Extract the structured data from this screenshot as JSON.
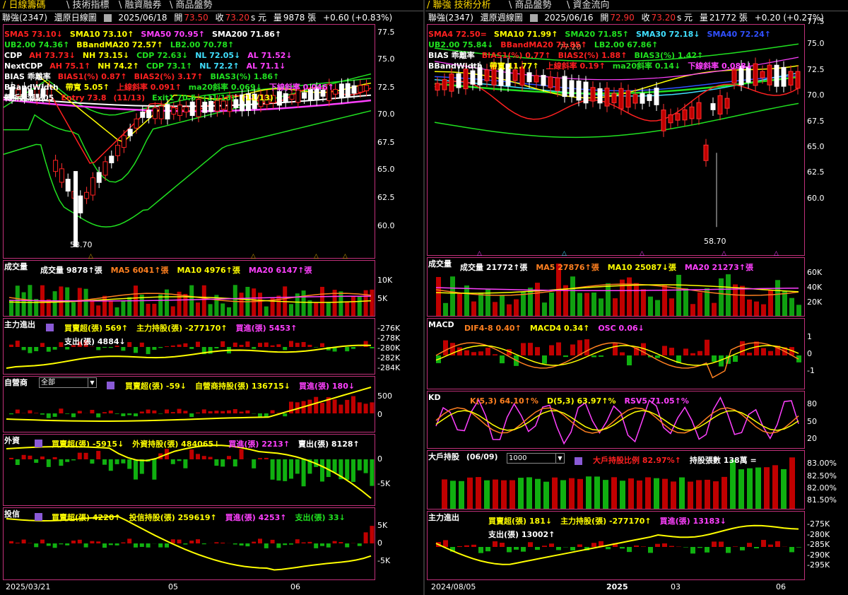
{
  "left": {
    "tabs": [
      "日線籌碼",
      "技術指標",
      "融資融券",
      "商品盤勢"
    ],
    "header": {
      "stock": "聯強(2347)",
      "view": "還原日線圖",
      "date": "2025/06/18",
      "open_l": "開",
      "open": "73.50",
      "close_l": "收",
      "close": "73.20",
      "unit": "s 元",
      "vol_l": "量",
      "vol": "9878 張",
      "chg": "+0.60 (+0.83%)"
    },
    "main_legend": [
      {
        "t": "SMA5 73.10↓",
        "c": "#ff2020"
      },
      {
        "t": "SMA10 73.10↑",
        "c": "#ffff00"
      },
      {
        "t": "SMA50 70.95↑",
        "c": "#ff40ff"
      },
      {
        "t": "SMA200 71.86↑",
        "c": "#ffffff"
      },
      {
        "t": "UB2.00 74.36↑",
        "c": "#20e020"
      },
      {
        "t": "BBandMA20 72.57↑",
        "c": "#ffff00"
      },
      {
        "t": "LB2.00 70.78↑",
        "c": "#20e020"
      },
      {
        "t": "CDP",
        "c": "#ffffff"
      },
      {
        "t": "AH 73.73↓",
        "c": "#ff2020"
      },
      {
        "t": "NH 73.15↓",
        "c": "#ffff00"
      },
      {
        "t": "CDP 72.63↓",
        "c": "#20e020"
      },
      {
        "t": "NL 72.05↓",
        "c": "#40e0ff"
      },
      {
        "t": "AL 71.52↓",
        "c": "#ff40ff"
      },
      {
        "t": "NextCDP",
        "c": "#ffffff"
      },
      {
        "t": "AH 75.1↑",
        "c": "#ff2020"
      },
      {
        "t": "NH 74.2↑",
        "c": "#ffff00"
      },
      {
        "t": "CDP 73.1↑",
        "c": "#20e020"
      },
      {
        "t": "NL 72.2↑",
        "c": "#40e0ff"
      },
      {
        "t": "AL 71.1↓",
        "c": "#ff40ff"
      },
      {
        "t": "BIAS 乖離率",
        "c": "#ffffff"
      },
      {
        "t": "BIAS1(%) 0.87↑",
        "c": "#ff2020"
      },
      {
        "t": "BIAS2(%) 3.17↑",
        "c": "#ff2020"
      },
      {
        "t": "BIAS3(%) 1.86↑",
        "c": "#20e020"
      },
      {
        "t": "BBandWidth",
        "c": "#ffffff"
      },
      {
        "t": "帶寬 5.05↑",
        "c": "#ffff00"
      },
      {
        "t": "上線斜率 0.091↑",
        "c": "#ff2020"
      },
      {
        "t": "ma20斜率 0.069↓",
        "c": "#20e020"
      },
      {
        "t": "下線斜率 0.046↑",
        "c": "#ff40ff"
      },
      {
        "t": "轉折起漲點05",
        "c": "#ffffff"
      },
      {
        "t": "Entry 73.8",
        "c": "#ff2020"
      },
      {
        "t": "(11/13)",
        "c": "#ff2020"
      },
      {
        "t": "Exit1 70.5",
        "c": "#20e020"
      },
      {
        "t": "(11/13)",
        "c": "#20e020"
      },
      {
        "t": "(11/13)",
        "c": "#ffff00"
      }
    ],
    "y_main": [
      "77.5",
      "75.0",
      "72.5",
      "70.0",
      "67.5",
      "65.0",
      "62.5",
      "60.0"
    ],
    "low_label": "58.70",
    "vol_panel": {
      "name": "成交量",
      "legend": [
        {
          "t": "成交量 9878↑張",
          "c": "#fff"
        },
        {
          "t": "MA5 6041↑張",
          "c": "#ff8020"
        },
        {
          "t": "MA10 4976↑張",
          "c": "#ffff00"
        },
        {
          "t": "MA20 6147↑張",
          "c": "#ff40ff"
        }
      ],
      "y": [
        "10K",
        "5K"
      ]
    },
    "p_main": {
      "name": "主力進出",
      "legend": [
        {
          "t": "買賣超(張) 569↑",
          "c": "#ffff00"
        },
        {
          "t": "主力持股(張) -277170↑",
          "c": "#ffff00"
        },
        {
          "t": "買進(張) 5453↑",
          "c": "#ff40ff"
        },
        {
          "t": "支出(張) 4884↓",
          "c": "#fff"
        }
      ],
      "y": [
        "-276K",
        "-278K",
        "-280K",
        "-282K",
        "-284K"
      ]
    },
    "p_dealer": {
      "name": "自營商",
      "select": "全部",
      "legend": [
        {
          "t": "買賣超(張) -59↓",
          "c": "#ffff00"
        },
        {
          "t": "自營商持股(張) 136715↓",
          "c": "#ffff00"
        },
        {
          "t": "買進(張) 180↓",
          "c": "#ff40ff"
        }
      ],
      "y": [
        "500",
        "0"
      ]
    },
    "p_foreign": {
      "name": "外資",
      "legend": [
        {
          "t": "買賣超(張) -5915↓",
          "c": "#ffff00"
        },
        {
          "t": "外資持股(張) 484065↓",
          "c": "#ffff00"
        },
        {
          "t": "買進(張) 2213↑",
          "c": "#ff40ff"
        },
        {
          "t": "賣出(張) 8128↑",
          "c": "#fff"
        }
      ],
      "y": [
        "0",
        "-5K"
      ]
    },
    "p_trust": {
      "name": "投信",
      "legend": [
        {
          "t": "買賣超(張) 4220↑",
          "c": "#ffff00"
        },
        {
          "t": "投信持股(張) 259619↑",
          "c": "#ffff00"
        },
        {
          "t": "買進(張) 4253↑",
          "c": "#ff40ff"
        },
        {
          "t": "支出(張) 33↓",
          "c": "#20e020"
        }
      ],
      "y": [
        "5K",
        "0",
        "-5K"
      ]
    },
    "x_axis": [
      "2025/03/21",
      "05",
      "06"
    ]
  },
  "right": {
    "tabs": [
      "聯強 技術分析",
      "商品盤勢",
      "資金流向"
    ],
    "header": {
      "stock": "聯強(2347)",
      "view": "還原週線圖",
      "date": "2025/06/16",
      "open_l": "開",
      "open": "72.90",
      "close_l": "收",
      "close": "73.20",
      "unit": "s 元",
      "vol_l": "量",
      "vol": "21772 張",
      "chg": "+0.20 (+0.27%)"
    },
    "main_legend": [
      {
        "t": "SMA4 72.50=",
        "c": "#ff2020"
      },
      {
        "t": "SMA10 71.99↑",
        "c": "#ffff00"
      },
      {
        "t": "SMA20 71.85↑",
        "c": "#20e020"
      },
      {
        "t": "SMA30 72.18↓",
        "c": "#40e0ff"
      },
      {
        "t": "SMA40 72.24↑",
        "c": "#3050ff"
      },
      {
        "t": "UB2.00 75.84↓",
        "c": "#20e020"
      },
      {
        "t": "BBandMA20 71.85↑",
        "c": "#ff2020"
      },
      {
        "t": "LB2.00 67.86↑",
        "c": "#20e020"
      },
      {
        "t": "BIAS 乖離率",
        "c": "#ffffff"
      },
      {
        "t": "BIAS1(%) 0.77↑",
        "c": "#ff2020"
      },
      {
        "t": "BIAS2(%) 1.88↑",
        "c": "#ff2020"
      },
      {
        "t": "BIAS3(%) 1.42↑",
        "c": "#20e020"
      },
      {
        "t": "BBandWidth",
        "c": "#ffffff"
      },
      {
        "t": "帶寬 11.77↑",
        "c": "#ffff00"
      },
      {
        "t": "上線斜率 0.19↑",
        "c": "#ff2020"
      },
      {
        "t": "ma20斜率 0.14↓",
        "c": "#20e020"
      },
      {
        "t": "下線斜率 0.088↓",
        "c": "#ff40ff"
      }
    ],
    "y_main": [
      "75.0",
      "72.5",
      "70.0",
      "67.5",
      "65.0",
      "62.5",
      "60.0"
    ],
    "y_top": "77.5",
    "hi_label": "77.20",
    "low_label": "58.70",
    "vol_panel": {
      "name": "成交量",
      "legend": [
        {
          "t": "成交量 21772↑張",
          "c": "#fff"
        },
        {
          "t": "MA5 27876↑張",
          "c": "#ff8020"
        },
        {
          "t": "MA10 25087↓張",
          "c": "#ffff00"
        },
        {
          "t": "MA20 21273↑張",
          "c": "#ff40ff"
        }
      ],
      "y": [
        "60K",
        "40K",
        "20K"
      ]
    },
    "macd": {
      "name": "MACD",
      "legend": [
        {
          "t": "DIF4-8 0.40↑",
          "c": "#ff8020"
        },
        {
          "t": "MACD4 0.34↑",
          "c": "#ffff00"
        },
        {
          "t": "OSC 0.06↓",
          "c": "#ff40ff"
        }
      ],
      "y": [
        "1",
        "0",
        "-1"
      ]
    },
    "kd": {
      "name": "KD",
      "legend": [
        {
          "t": "K(5,3) 64.10↑%",
          "c": "#ff8020"
        },
        {
          "t": "D(5,3) 63.97↑%",
          "c": "#ffff00"
        },
        {
          "t": "RSV5 71.05↑%",
          "c": "#ff40ff"
        }
      ],
      "y": [
        "80",
        "50",
        "20"
      ]
    },
    "holders": {
      "name": "大戶持股",
      "period": "(06/09)",
      "select": "1000",
      "legend": [
        {
          "t": "大戶持股比例 82.97%↑",
          "c": "#ff2020"
        },
        {
          "t": "持股張數 138萬 =",
          "c": "#fff"
        }
      ],
      "y": [
        "83.00%",
        "82.50%",
        "82.00%",
        "81.50%"
      ]
    },
    "p_main": {
      "name": "主力進出",
      "legend": [
        {
          "t": "買賣超(張) 181↓",
          "c": "#ffff00"
        },
        {
          "t": "主力持股(張) -277170↑",
          "c": "#ffff00"
        },
        {
          "t": "買進(張) 13183↓",
          "c": "#ff40ff"
        },
        {
          "t": "支出(張) 13002↑",
          "c": "#fff"
        }
      ],
      "y": [
        "-275K",
        "-280K",
        "-285K",
        "-290K",
        "-295K"
      ]
    },
    "x_axis": [
      "2024/08/05",
      "2025",
      "03",
      "06"
    ]
  }
}
